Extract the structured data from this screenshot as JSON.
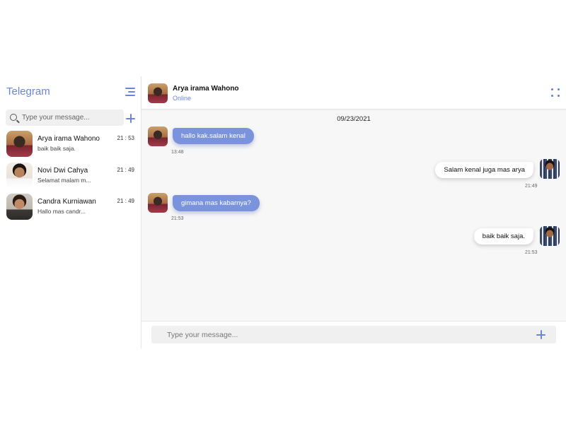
{
  "sidebar": {
    "title": "Telegram",
    "search_placeholder": "Type your message...",
    "chats": [
      {
        "name": "Arya irama Wahono",
        "preview": "baik baik saja.",
        "time": "21 : 53"
      },
      {
        "name": "Novi Dwi Cahya",
        "preview": "Selamat malam m...",
        "time": "21 : 49"
      },
      {
        "name": "Candra Kurniawan",
        "preview": "Hallo mas candr...",
        "time": "21 : 49"
      }
    ]
  },
  "header": {
    "name": "Arya irama Wahono",
    "status": "Online"
  },
  "conversation": {
    "date": "09/23/2021",
    "messages": [
      {
        "direction": "in",
        "text": "hallo kak.salam kenal",
        "time": "13:48"
      },
      {
        "direction": "out",
        "text": "Salam kenal juga mas arya",
        "time": "21:49"
      },
      {
        "direction": "in",
        "text": "gimana mas kabarnya?",
        "time": "21:53"
      },
      {
        "direction": "out",
        "text": "baik baik saja.",
        "time": "21:53"
      }
    ]
  },
  "composer": {
    "placeholder": "Type your message..."
  },
  "icons": {
    "menu": "menu-lines-icon",
    "search": "search-icon",
    "add": "plus-icon",
    "more": "dots-icon"
  },
  "colors": {
    "accent": "#6a86d4",
    "incoming_bubble": "#7b93dd",
    "outgoing_bubble": "#ffffff",
    "chat_background": "#f7f7f7"
  }
}
